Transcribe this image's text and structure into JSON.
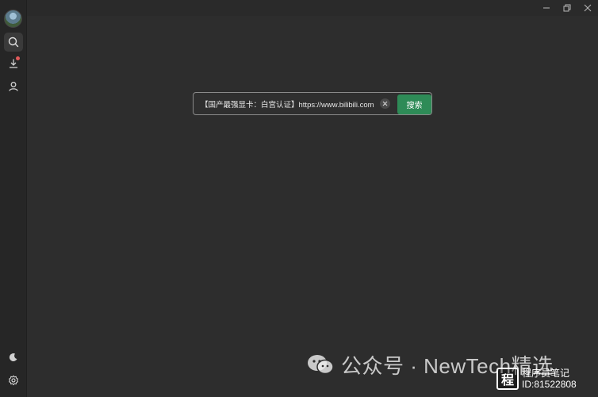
{
  "window": {
    "controls": [
      {
        "name": "minimize-button",
        "glyph": "—"
      },
      {
        "name": "restore-button",
        "glyph": "⧉"
      },
      {
        "name": "close-button",
        "glyph": "✕"
      }
    ]
  },
  "sidebar": {
    "items": [
      {
        "name": "search",
        "icon": "search-icon",
        "active": true
      },
      {
        "name": "downloads",
        "icon": "download-icon",
        "badge": true
      },
      {
        "name": "account",
        "icon": "user-icon"
      }
    ],
    "bottom": [
      {
        "name": "theme",
        "icon": "moon-icon"
      },
      {
        "name": "settings",
        "icon": "gear-icon"
      }
    ]
  },
  "search": {
    "value": "【国产最强显卡：白宫认证】https://www.bilibili.com",
    "button_label": "搜索"
  },
  "watermark": {
    "text": "公众号 · NewTech精选"
  },
  "badge": {
    "line1": "程序员笔记",
    "line2": "ID:81522808",
    "glyph": "程"
  }
}
